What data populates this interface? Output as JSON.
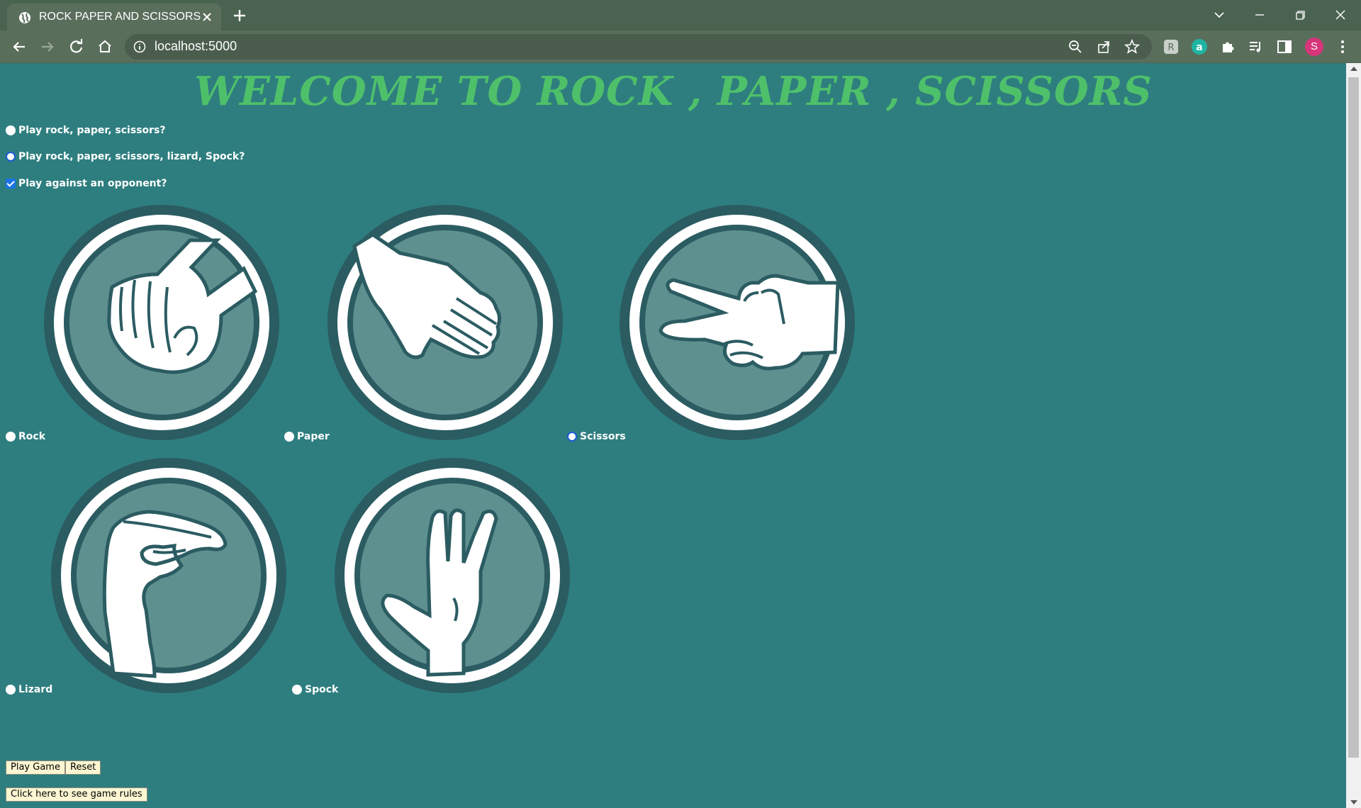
{
  "browser": {
    "tab_title": "ROCK PAPER AND SCISSORS",
    "url": "localhost:5000",
    "profile_initial": "S"
  },
  "page": {
    "heading": "WELCOME TO ROCK , PAPER , SCISSORS",
    "options": [
      {
        "label": "Play rock, paper, scissors?",
        "type": "radio",
        "checked": false
      },
      {
        "label": "Play rock, paper, scissors, lizard, Spock?",
        "type": "radio",
        "checked": true
      },
      {
        "label": "Play against an opponent?",
        "type": "checkbox",
        "checked": true
      }
    ],
    "choices": [
      {
        "label": "Rock",
        "icon": "rock-hand-icon",
        "selected": false
      },
      {
        "label": "Paper",
        "icon": "paper-hand-icon",
        "selected": false
      },
      {
        "label": "Scissors",
        "icon": "scissors-hand-icon",
        "selected": true
      },
      {
        "label": "Lizard",
        "icon": "lizard-hand-icon",
        "selected": false
      },
      {
        "label": "Spock",
        "icon": "spock-hand-icon",
        "selected": false
      }
    ],
    "buttons": {
      "play": "Play Game",
      "reset": "Reset",
      "rules": "Click here to see game rules"
    }
  },
  "colors": {
    "background": "#2e7e7f",
    "heading": "#4fc06a",
    "icon_dark": "#2b5c62",
    "icon_mid": "#5f9090",
    "button_bg": "#fdf6d2"
  }
}
